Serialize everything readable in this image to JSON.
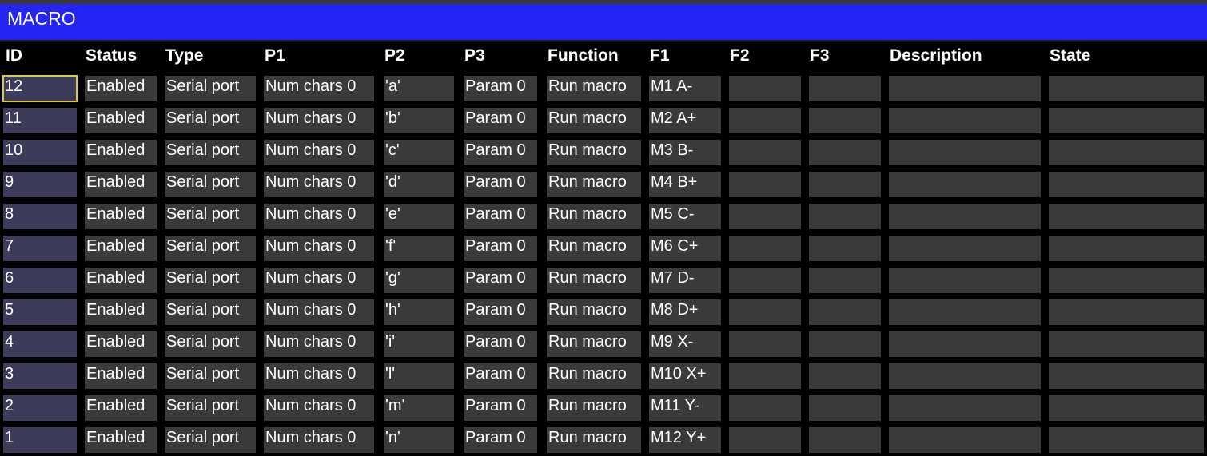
{
  "window": {
    "title": "MACRO"
  },
  "columns": [
    "ID",
    "Status",
    "Type",
    "P1",
    "P2",
    "P3",
    "Function",
    "F1",
    "F2",
    "F3",
    "Description",
    "State"
  ],
  "rows": [
    {
      "id": "12",
      "status": "Enabled",
      "type": "Serial port",
      "p1": "Num chars 0",
      "p2": "'a'",
      "p3": "Param 0",
      "function": "Run macro",
      "f1": "M1 A-",
      "f2": "",
      "f3": "",
      "description": "",
      "state": "",
      "selected": true
    },
    {
      "id": "11",
      "status": "Enabled",
      "type": "Serial port",
      "p1": "Num chars 0",
      "p2": "'b'",
      "p3": "Param 0",
      "function": "Run macro",
      "f1": "M2 A+",
      "f2": "",
      "f3": "",
      "description": "",
      "state": ""
    },
    {
      "id": "10",
      "status": "Enabled",
      "type": "Serial port",
      "p1": "Num chars 0",
      "p2": "'c'",
      "p3": "Param 0",
      "function": "Run macro",
      "f1": "M3 B-",
      "f2": "",
      "f3": "",
      "description": "",
      "state": ""
    },
    {
      "id": "9",
      "status": "Enabled",
      "type": "Serial port",
      "p1": "Num chars 0",
      "p2": "'d'",
      "p3": "Param 0",
      "function": "Run macro",
      "f1": "M4 B+",
      "f2": "",
      "f3": "",
      "description": "",
      "state": ""
    },
    {
      "id": "8",
      "status": "Enabled",
      "type": "Serial port",
      "p1": "Num chars 0",
      "p2": "'e'",
      "p3": "Param 0",
      "function": "Run macro",
      "f1": "M5 C-",
      "f2": "",
      "f3": "",
      "description": "",
      "state": ""
    },
    {
      "id": "7",
      "status": "Enabled",
      "type": "Serial port",
      "p1": "Num chars 0",
      "p2": "'f'",
      "p3": "Param 0",
      "function": "Run macro",
      "f1": "M6 C+",
      "f2": "",
      "f3": "",
      "description": "",
      "state": ""
    },
    {
      "id": "6",
      "status": "Enabled",
      "type": "Serial port",
      "p1": "Num chars 0",
      "p2": "'g'",
      "p3": "Param 0",
      "function": "Run macro",
      "f1": "M7 D-",
      "f2": "",
      "f3": "",
      "description": "",
      "state": ""
    },
    {
      "id": "5",
      "status": "Enabled",
      "type": "Serial port",
      "p1": "Num chars 0",
      "p2": "'h'",
      "p3": "Param 0",
      "function": "Run macro",
      "f1": "M8 D+",
      "f2": "",
      "f3": "",
      "description": "",
      "state": ""
    },
    {
      "id": "4",
      "status": "Enabled",
      "type": "Serial port",
      "p1": "Num chars 0",
      "p2": "'i'",
      "p3": "Param 0",
      "function": "Run macro",
      "f1": "M9 X-",
      "f2": "",
      "f3": "",
      "description": "",
      "state": ""
    },
    {
      "id": "3",
      "status": "Enabled",
      "type": "Serial port",
      "p1": "Num chars 0",
      "p2": "'l'",
      "p3": "Param 0",
      "function": "Run macro",
      "f1": "M10 X+",
      "f2": "",
      "f3": "",
      "description": "",
      "state": ""
    },
    {
      "id": "2",
      "status": "Enabled",
      "type": "Serial port",
      "p1": "Num chars 0",
      "p2": "'m'",
      "p3": "Param 0",
      "function": "Run macro",
      "f1": "M11 Y-",
      "f2": "",
      "f3": "",
      "description": "",
      "state": ""
    },
    {
      "id": "1",
      "status": "Enabled",
      "type": "Serial port",
      "p1": "Num chars 0",
      "p2": "'n'",
      "p3": "Param 0",
      "function": "Run macro",
      "f1": "M12 Y+",
      "f2": "",
      "f3": "",
      "description": "",
      "state": ""
    }
  ],
  "colors": {
    "title_bar": "#2424f5",
    "background": "#000000",
    "cell": "#3a3a3a",
    "id_cell": "#3c3c5a",
    "selection": "#d8c940"
  }
}
